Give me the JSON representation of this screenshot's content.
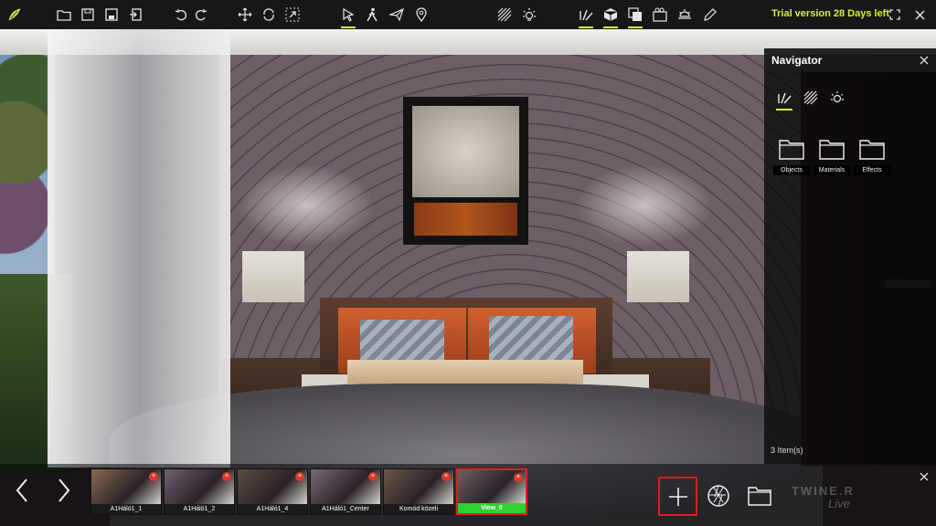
{
  "toolbar": {
    "icons": [
      "logo-icon",
      "open-folder-icon",
      "save-icon",
      "save-as-icon",
      "import-icon",
      "undo-icon",
      "redo-icon",
      "move-icon",
      "rotate-icon",
      "scale-icon",
      "select-icon",
      "walk-icon",
      "fly-icon",
      "location-icon",
      "material-icon",
      "light-icon",
      "brush-icon",
      "object-icon",
      "library-icon",
      "camera-icon",
      "sun-icon",
      "edit-icon",
      "fullscreen-icon",
      "close-icon"
    ],
    "trial_text": "Trial version 28 Days left"
  },
  "navigator": {
    "title": "Navigator",
    "folders": [
      {
        "label": "Objects"
      },
      {
        "label": "Materials"
      },
      {
        "label": "Effects"
      }
    ],
    "item_count": "3 Item(s)"
  },
  "views": [
    {
      "label": "A1Háló1_1",
      "tint": "#8a6a4e"
    },
    {
      "label": "A1Háló1_2",
      "tint": "#6e6270"
    },
    {
      "label": "A1Háló1_4",
      "tint": "#5b4c40"
    },
    {
      "label": "A1Háló1_Center",
      "tint": "#7a6a72"
    },
    {
      "label": "Komód közeli",
      "tint": "#6b5746"
    },
    {
      "label": "View_0",
      "tint": "#6d5f66"
    }
  ],
  "watermark": {
    "brand": "TWINE.R",
    "live": "Live"
  },
  "colors": {
    "accent": "#d8ef3a",
    "active_view": "#2fd02f",
    "delete": "#d83a2b",
    "highlight_border": "#d62020"
  }
}
